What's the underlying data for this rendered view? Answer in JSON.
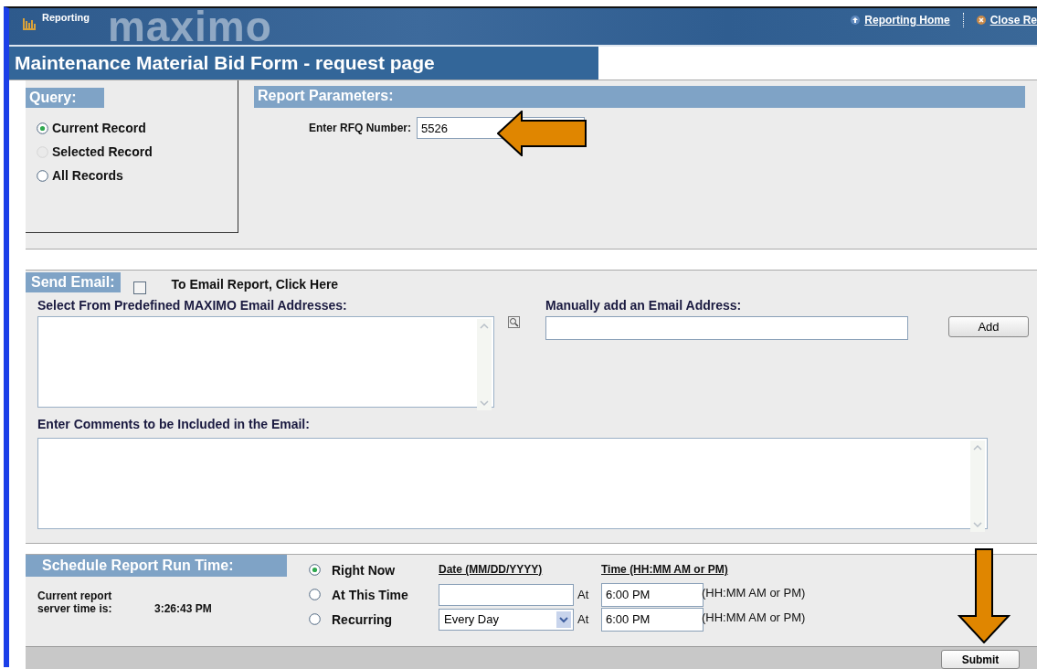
{
  "header": {
    "app": "Reporting",
    "logo": "maximo",
    "links": [
      {
        "label": "Reporting Home",
        "kind": "home"
      },
      {
        "label": "Close Re",
        "kind": "close"
      }
    ]
  },
  "page_title": "Maintenance Material Bid Form - request page",
  "query": {
    "title": "Query:",
    "options": [
      {
        "label": "Current Record",
        "selected": true,
        "disabled": false
      },
      {
        "label": "Selected Record",
        "selected": false,
        "disabled": true
      },
      {
        "label": "All Records",
        "selected": false,
        "disabled": false
      }
    ]
  },
  "report_parameters": {
    "title": "Report Parameters:",
    "rfq_label": "Enter RFQ Number:",
    "rfq_value": "5526",
    "callout_arrow": true
  },
  "send_email": {
    "title": "Send Email:",
    "checkbox": {
      "label": "To Email Report, Click Here",
      "checked": false
    },
    "predefined_label": "Select From Predefined MAXIMO Email Addresses:",
    "manual_label": "Manually add an Email Address:",
    "add_button": "Add",
    "comments_label": "Enter Comments to be Included in the Email:"
  },
  "schedule": {
    "title": "Schedule Report Run Time:",
    "server_time_label": "Current report server time is:",
    "server_time": "3:26:43 PM",
    "date_heading": "Date (MM/DD/YYYY)",
    "time_heading": "Time (HH:MM AM or PM)",
    "options": [
      {
        "label": "Right Now",
        "selected": true
      },
      {
        "label": "At This Time",
        "selected": false,
        "kind": "date",
        "at": "At",
        "time": "6:00 PM",
        "hint": "(HH:MM AM or PM)"
      },
      {
        "label": "Recurring",
        "selected": false,
        "kind": "select",
        "value": "Every Day",
        "at": "At",
        "time": "6:00 PM",
        "hint": "(HH:MM AM or PM)"
      }
    ]
  },
  "submit_button": "Submit",
  "submit_callout_arrow": true
}
